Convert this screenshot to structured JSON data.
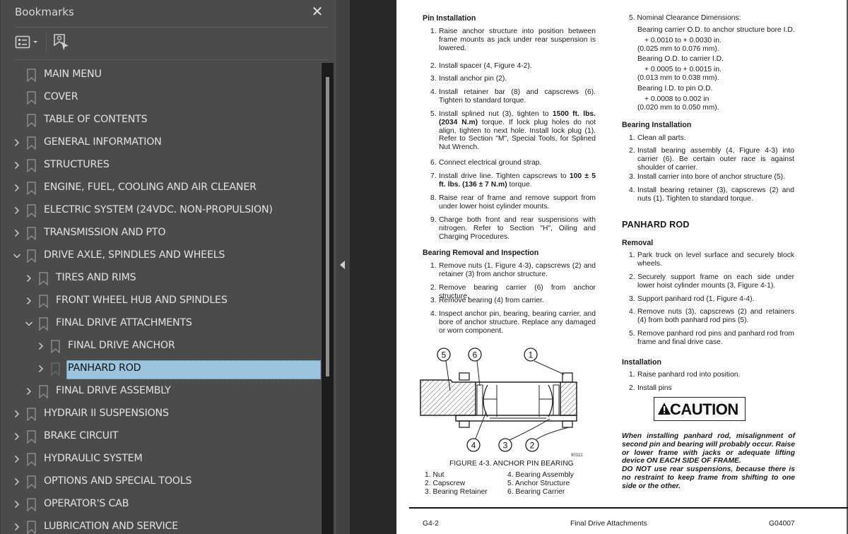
{
  "sidebar": {
    "title": "Bookmarks",
    "close_icon": "close-icon",
    "toolbar": {
      "options_icon": "list-options-icon",
      "find_icon": "find-current-bookmark-icon"
    },
    "items": [
      {
        "label": "MAIN MENU",
        "level": 0,
        "expander": "none"
      },
      {
        "label": "COVER",
        "level": 0,
        "expander": "none"
      },
      {
        "label": "TABLE OF CONTENTS",
        "level": 0,
        "expander": "none"
      },
      {
        "label": "GENERAL INFORMATION",
        "level": 0,
        "expander": "collapsed"
      },
      {
        "label": "STRUCTURES",
        "level": 0,
        "expander": "collapsed"
      },
      {
        "label": "ENGINE, FUEL, COOLING AND AIR CLEANER",
        "level": 0,
        "expander": "collapsed"
      },
      {
        "label": "ELECTRIC SYSTEM (24VDC. NON-PROPULSION)",
        "level": 0,
        "expander": "collapsed"
      },
      {
        "label": "TRANSMISSION AND PTO",
        "level": 0,
        "expander": "collapsed"
      },
      {
        "label": "DRIVE AXLE, SPINDLES AND WHEELS",
        "level": 0,
        "expander": "expanded"
      },
      {
        "label": "TIRES AND RIMS",
        "level": 1,
        "expander": "collapsed"
      },
      {
        "label": "FRONT WHEEL HUB AND SPINDLES",
        "level": 1,
        "expander": "collapsed"
      },
      {
        "label": "FINAL DRIVE ATTACHMENTS",
        "level": 1,
        "expander": "expanded"
      },
      {
        "label": "FINAL DRIVE ANCHOR",
        "level": 2,
        "expander": "collapsed"
      },
      {
        "label": "PANHARD ROD",
        "level": 2,
        "expander": "collapsed",
        "selected": true
      },
      {
        "label": "FINAL DRIVE ASSEMBLY",
        "level": 1,
        "expander": "collapsed"
      },
      {
        "label": "HYDRAIR II SUSPENSIONS",
        "level": 0,
        "expander": "collapsed"
      },
      {
        "label": "BRAKE CIRCUIT",
        "level": 0,
        "expander": "collapsed"
      },
      {
        "label": "HYDRAULIC SYSTEM",
        "level": 0,
        "expander": "collapsed"
      },
      {
        "label": "OPTIONS AND SPECIAL TOOLS",
        "level": 0,
        "expander": "collapsed"
      },
      {
        "label": "OPERATOR'S CAB",
        "level": 0,
        "expander": "collapsed"
      },
      {
        "label": "LUBRICATION AND SERVICE",
        "level": 0,
        "expander": "collapsed"
      }
    ],
    "selection_color": "#9cc4de"
  },
  "collapse_panel_icon": "collapse-left-icon",
  "document": {
    "left": {
      "pin_installation": {
        "heading": "Pin Installation",
        "steps": [
          {
            "n": "1.",
            "html": "Raise anchor structure into position between frame mounts as jack under rear suspension is lowered."
          },
          {
            "n": "2.",
            "html": "Install spacer (4, Figure 4-2)."
          },
          {
            "n": "3.",
            "html": "Install anchor pin (2)."
          },
          {
            "n": "4.",
            "html": "Install retainer bar (8) and capscrews (6). Tighten to standard torque."
          },
          {
            "n": "5.",
            "html": "Install splined nut (3), tighten to <b>1500 ft. lbs. (2034 N.m)</b> torque. If lock plug holes do not align, tighten to next hole. Install lock plug (1). Refer to Section \"M\", Special Tools, for Splined Nut Wrench."
          },
          {
            "n": "6.",
            "html": "Connect electrical ground strap."
          },
          {
            "n": "7.",
            "html": "Install drive line. Tighten capscrews to <b>100 ± 5 ft. lbs. (136 ± 7 N.m)</b> torque."
          },
          {
            "n": "8.",
            "html": "Raise rear of frame and remove support from under lower hoist cylinder mounts."
          },
          {
            "n": "9.",
            "html": "Charge both front and rear suspensions with nitrogen. Refer to Section \"H\", Oiling and Charging Procedures."
          }
        ]
      },
      "bearing_removal": {
        "heading": "Bearing Removal and Inspection",
        "steps": [
          {
            "n": "1.",
            "html": "Remove nuts (1, Figure 4-3), capscrews (2) and retainer (3) from anchor structure."
          },
          {
            "n": "2.",
            "html": "Remove bearing carrier (6) from anchor structure."
          },
          {
            "n": "3.",
            "html": "Remove bearing (4) from carrier."
          },
          {
            "n": "4.",
            "html": "Inspect anchor pin, bearing, bearing carrier, and bore of anchor structure. Replace any damaged or worn component."
          }
        ]
      },
      "figure": {
        "callouts": [
          "5",
          "6",
          "1",
          "4",
          "3",
          "2"
        ],
        "drawing_id": "90321",
        "caption": "FIGURE 4-3. ANCHOR PIN BEARING",
        "legend": [
          "1. Nut",
          "2. Capscrew",
          "3. Bearing Retainer",
          "4. Bearing Assembly",
          "5. Anchor Structure",
          "6. Bearing Carrier"
        ]
      }
    },
    "right": {
      "clearance": {
        "title": "5. Nominal Clearance Dimensions:",
        "rows": [
          {
            "label": "Bearing carrier O.D. to anchor structure bore I.D.",
            "in": "+ 0.0010 to + 0.0030 in.",
            "mm": "(0.025 mm to 0.076 mm)."
          },
          {
            "label": "Bearing O.D. to carrier I.D.",
            "in": "+ 0.0005 to + 0.0015 in.",
            "mm": "(0.013 mm to 0.038 mm)."
          },
          {
            "label": "Bearing I.D. to pin O.D.",
            "in": "+ 0.0008 to 0.002 in",
            "mm": "(0.020 mm to 0.050 mm)."
          }
        ]
      },
      "bearing_installation": {
        "heading": "Bearing Installation",
        "steps": [
          {
            "n": "1.",
            "html": "Clean all parts."
          },
          {
            "n": "2.",
            "html": "Install bearing assembly (4, Figure 4-3) into carrier (6). Be certain outer race is against shoulder of carrier."
          },
          {
            "n": "3.",
            "html": "Install carrier into bore of anchor structure (5)."
          },
          {
            "n": "4.",
            "html": "Install bearing retainer (3), capscrews (2) and nuts (1). Tighten to standard torque."
          }
        ]
      },
      "panhard_heading": "PANHARD ROD",
      "removal": {
        "heading": "Removal",
        "steps": [
          {
            "n": "1.",
            "html": "Park truck on level surface and securely block wheels."
          },
          {
            "n": "2.",
            "html": "Securely support frame on each side under lower hoist cylinder mounts (3, Figure 4-1)."
          },
          {
            "n": "3.",
            "html": "Support panhard rod (1, Figure 4-4)."
          },
          {
            "n": "4.",
            "html": "Remove nuts (3), capscrews (2) and retainers (4) from both panhard rod pins (5)."
          },
          {
            "n": "5.",
            "html": "Remove panhard rod pins and panhard rod from frame and final drive case."
          }
        ]
      },
      "installation": {
        "heading": "Installation",
        "steps": [
          {
            "n": "1.",
            "html": "Raise panhard rod into position."
          },
          {
            "n": "2.",
            "html": "Install pins"
          }
        ]
      },
      "caution_label": "CAUTION",
      "caution_text_1": "When installing panhard rod, misalignment of second pin and bearing will probably occur. Raise or lower frame with jacks or adequate lifting device ON EACH SIDE OF FRAME.",
      "caution_text_2": "DO NOT use rear suspensions, because there is no restraint to keep frame from shifting to one side or the other."
    },
    "footer": {
      "page_number": "G4-2",
      "section": "Final Drive Attachments",
      "doc_code": "G04007"
    }
  }
}
